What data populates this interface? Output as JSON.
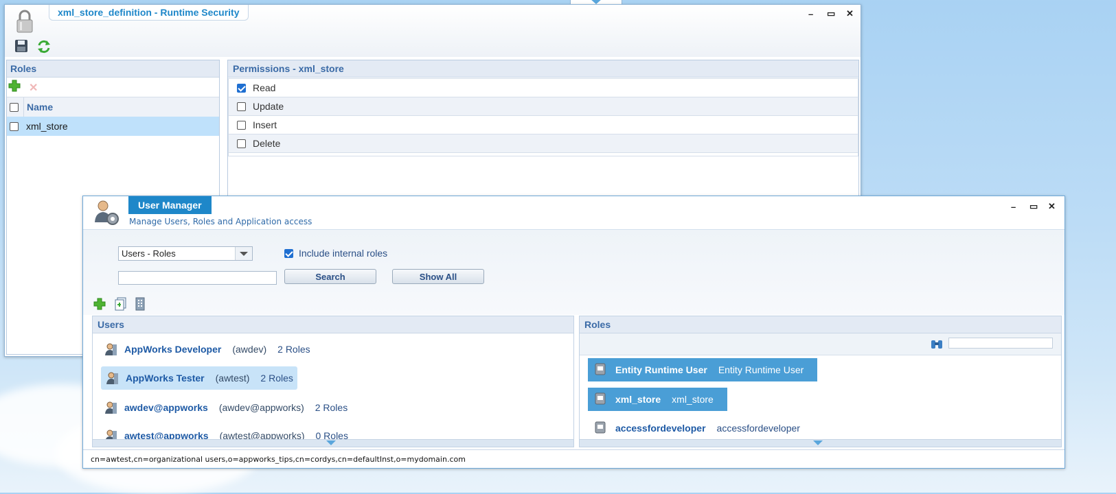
{
  "security_window": {
    "title": "xml_store_definition - Runtime Security",
    "roles_panel": {
      "header": "Roles",
      "column_name": "Name",
      "rows": [
        {
          "name": "xml_store",
          "checked": false,
          "selected": true
        }
      ]
    },
    "permissions_panel": {
      "header": "Permissions - xml_store",
      "items": [
        {
          "label": "Read",
          "checked": true
        },
        {
          "label": "Update",
          "checked": false
        },
        {
          "label": "Insert",
          "checked": false
        },
        {
          "label": "Delete",
          "checked": false
        }
      ]
    }
  },
  "user_manager": {
    "title": "User Manager",
    "subtitle": "Manage Users, Roles and Application access",
    "view_select": {
      "value": "Users - Roles"
    },
    "include_internal_roles": {
      "label": "Include internal roles",
      "checked": true
    },
    "search_input": {
      "value": "",
      "placeholder": ""
    },
    "search_button": "Search",
    "show_all_button": "Show All",
    "users_panel": {
      "header": "Users",
      "items": [
        {
          "name": "AppWorks Developer",
          "id": "(awdev)",
          "roles": "2 Roles",
          "selected": false
        },
        {
          "name": "AppWorks Tester",
          "id": "(awtest)",
          "roles": "2 Roles",
          "selected": true
        },
        {
          "name": "awdev@appworks",
          "id": "(awdev@appworks)",
          "roles": "2 Roles",
          "selected": false
        },
        {
          "name": "awtest@appworks",
          "id": "(awtest@appworks)",
          "roles": "0 Roles",
          "selected": false
        }
      ]
    },
    "roles_panel": {
      "header": "Roles",
      "filter": {
        "value": ""
      },
      "items": [
        {
          "name": "Entity Runtime User",
          "desc": "Entity Runtime User",
          "selected": true
        },
        {
          "name": "xml_store",
          "desc": "xml_store",
          "selected": true
        },
        {
          "name": "accessfordeveloper",
          "desc": "accessfordeveloper",
          "selected": false
        }
      ]
    },
    "status_bar": "cn=awtest,cn=organizational users,o=appworks_tips,cn=cordys,cn=defaultInst,o=mydomain.com"
  },
  "colors": {
    "accent": "#1e87c9",
    "selection": "#4a9ed6",
    "header_text": "#3a6aa6"
  }
}
